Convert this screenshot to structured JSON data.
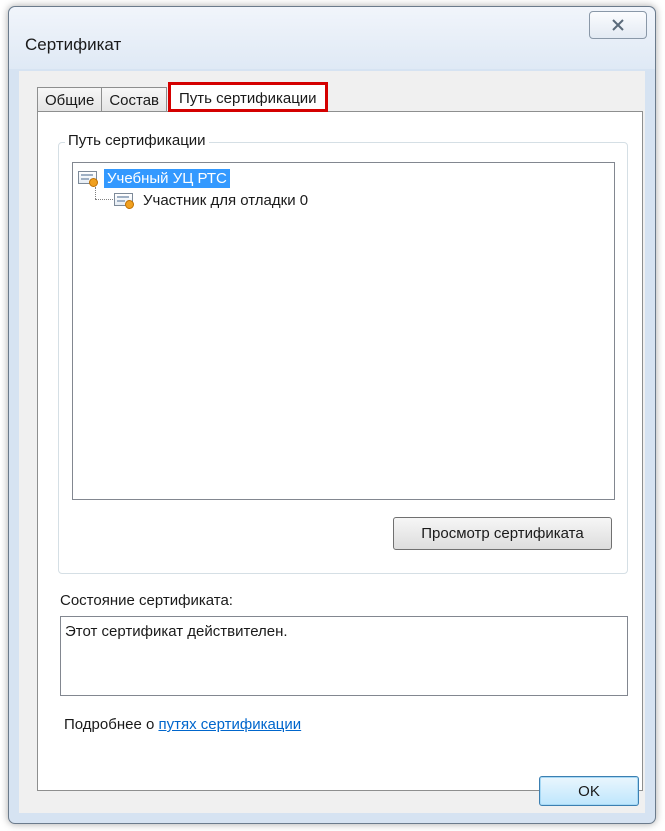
{
  "window": {
    "title": "Сертификат",
    "close_symbol": "✕"
  },
  "tabs": [
    {
      "label": "Общие",
      "active": false
    },
    {
      "label": "Состав",
      "active": false
    },
    {
      "label": "Путь сертификации",
      "active": true
    }
  ],
  "path_group": {
    "label": "Путь сертификации",
    "tree": [
      {
        "label": "Учебный УЦ РТС",
        "level": 0,
        "selected": true,
        "icon": "certificate-icon"
      },
      {
        "label": "Участник для отладки 0",
        "level": 1,
        "selected": false,
        "icon": "certificate-icon"
      }
    ],
    "view_button_label": "Просмотр сертификата"
  },
  "status": {
    "label": "Состояние сертификата:",
    "text": "Этот сертификат действителен."
  },
  "more_info": {
    "prefix": "Подробнее о ",
    "link_text": "путях сертификации"
  },
  "buttons": {
    "ok_label": "OK"
  },
  "colors": {
    "highlight": "#d40000",
    "selection": "#3399ff",
    "link": "#0066cc"
  }
}
